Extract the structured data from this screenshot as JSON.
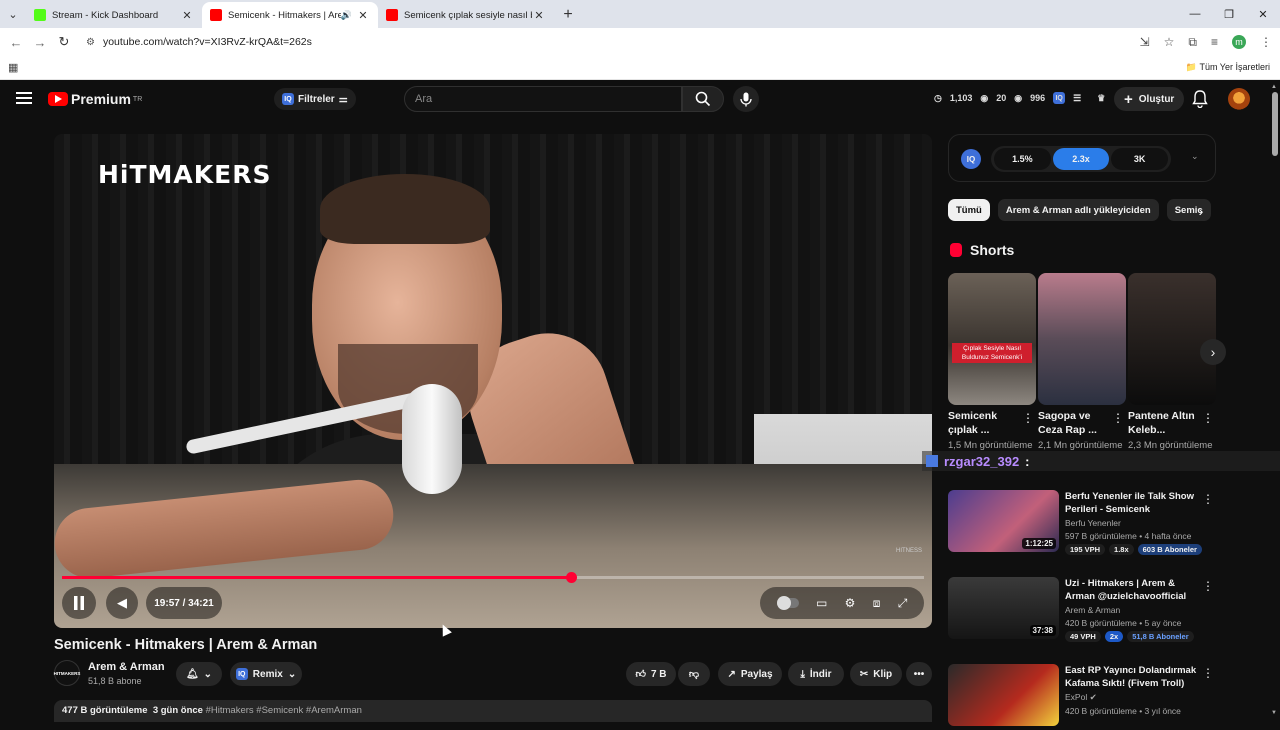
{
  "browser": {
    "tabs": [
      {
        "title": "Stream - Kick Dashboard",
        "favicon_color": "#53fc18"
      },
      {
        "title": "Semicenk - Hitmakers | Arem & Arman",
        "favicon_color": "#ff0000",
        "active": true
      },
      {
        "title": "Semicenk çıplak sesiyle nasıl bu...",
        "favicon_color": "#ff0000"
      }
    ],
    "url": "youtube.com/watch?v=XI3RvZ-krQA&t=262s",
    "profile_initial": "m",
    "bookmarks_label": "Tüm Yer İşaretleri"
  },
  "header": {
    "logo_text": "Premium",
    "logo_region": "TR",
    "filters_label": "Filtreler",
    "search_placeholder": "Ara",
    "stats": [
      "1,103",
      "20",
      "996"
    ],
    "create_label": "Oluştur"
  },
  "player": {
    "overlay_brand": "HiTMAKERS",
    "watermark": "HITNESS",
    "time": "19:57 / 34:21",
    "progress": 0.59
  },
  "video": {
    "title": "Semicenk - Hitmakers | Arem & Arman",
    "channel_avatar_text": "HITMAKERS",
    "channel": "Arem & Arman",
    "subscribers": "51,8 B abone",
    "remix_label": "Remix",
    "likes": "7 B",
    "share_label": "Paylaş",
    "download_label": "İndir",
    "clip_label": "Klip",
    "views_line": "477 B görüntüleme",
    "age": "3 gün önce",
    "tags": "#Hitmakers #Semicenk #AremArman"
  },
  "iq_panel": {
    "options": [
      "1.5%",
      "2.3x",
      "3K"
    ],
    "selected": 1
  },
  "chips": [
    "Tümü",
    "Arem & Arman adlı yükleyiciden",
    "Semic"
  ],
  "shorts": {
    "heading": "Shorts",
    "items": [
      {
        "title": "Semicenk çıplak ...",
        "views": "1,5 Mn görüntüleme",
        "caption": "Çıplak Sesiyle Nasıl Buldunuz Semicenk'i"
      },
      {
        "title": "Sagopa ve Ceza Rap ...",
        "views": "2,1 Mn görüntüleme"
      },
      {
        "title": "Pantene Altın Keleb...",
        "views": "2,3 Mn görüntüleme"
      }
    ]
  },
  "chat_overlay": {
    "user": "rzgar32_392",
    "sep": ":"
  },
  "recommended": [
    {
      "title": "Berfu Yenenler ile Talk Show Perileri - Semicenk",
      "channel": "Berfu Yenenler",
      "meta": "597 B görüntüleme • 4 hafta önce",
      "duration": "1:12:25",
      "badges": [
        "195 VPH",
        "1.8x",
        "603 B Aboneler"
      ]
    },
    {
      "title": "Uzi - Hitmakers | Arem & Arman @uzielchavoofficial",
      "channel": "Arem & Arman",
      "meta": "420 B görüntüleme • 5 ay önce",
      "duration": "37:38",
      "badges": [
        "49 VPH",
        "2x",
        "51,8 B Aboneler"
      ]
    },
    {
      "title": "East RP Yayıncı Dolandırmak Kafama Sıktı! (Fivem Troll)",
      "channel": "ExPol",
      "meta": "420 B görüntüleme • 3 yıl önce",
      "duration": "",
      "badges": []
    }
  ]
}
